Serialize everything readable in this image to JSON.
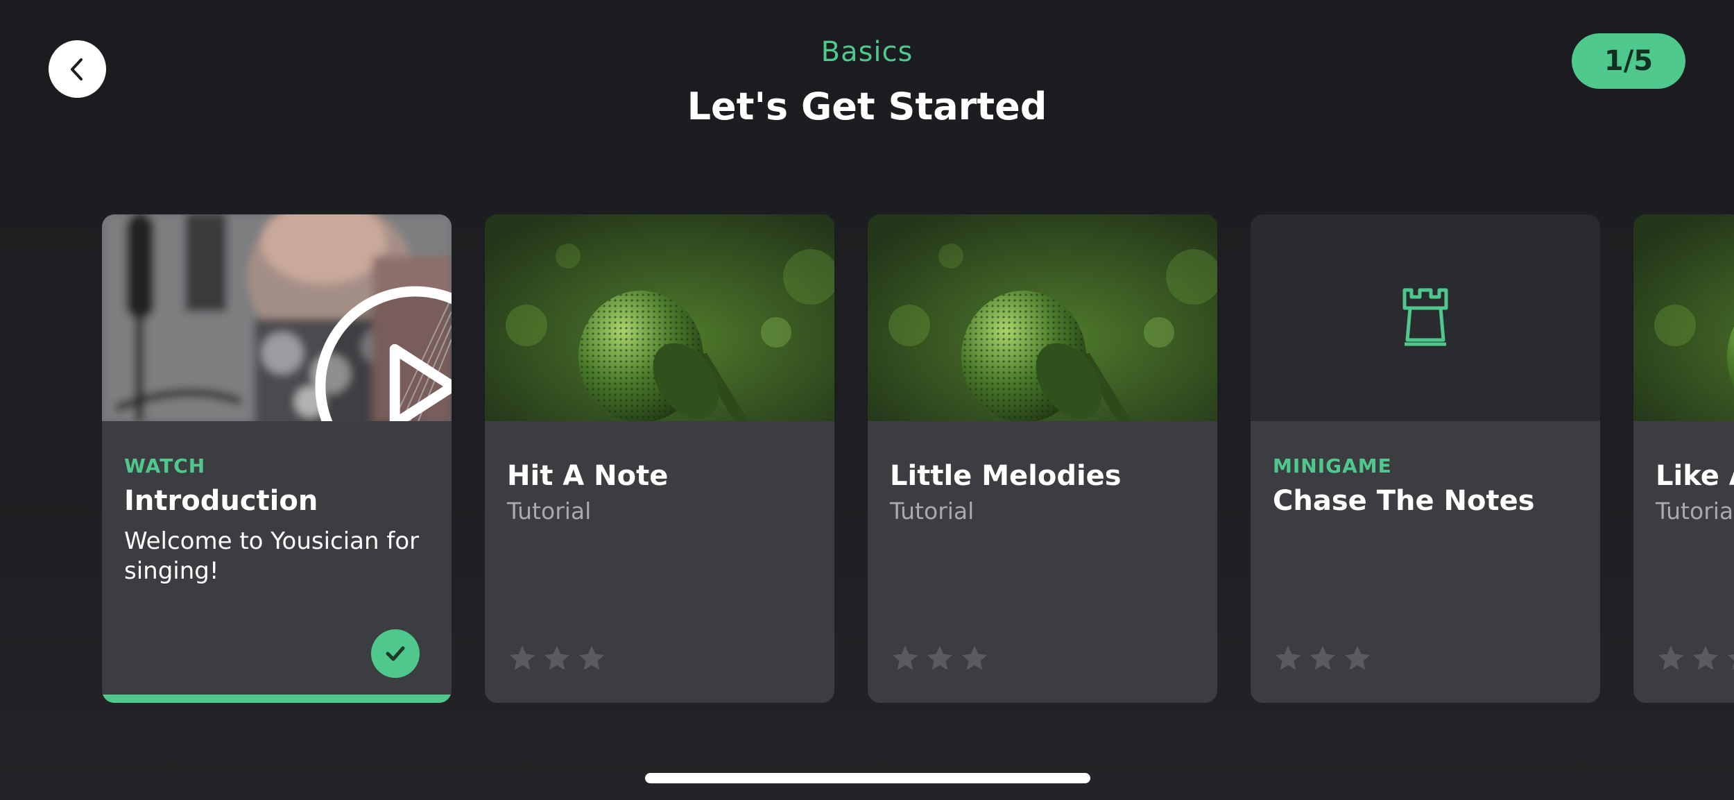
{
  "header": {
    "section": "Basics",
    "title": "Let's Get Started",
    "progress": "1/5"
  },
  "cards": [
    {
      "eyebrow": "WATCH",
      "title": "Introduction",
      "description": "Welcome to Yousician for singing!",
      "image": "singer-video-thumbnail",
      "completed": true
    },
    {
      "title": "Hit A Note",
      "subtitle": "Tutorial",
      "image": "microphone-green",
      "stars": 0
    },
    {
      "title": "Little Melodies",
      "subtitle": "Tutorial",
      "image": "microphone-green",
      "stars": 0
    },
    {
      "eyebrow": "MINIGAME",
      "title": "Chase The Notes",
      "image": "castle-tower-icon",
      "stars": 0
    },
    {
      "title": "Like A",
      "subtitle": "Tutoria",
      "image": "microphone-green",
      "stars": 0
    }
  ],
  "colors": {
    "accent": "#4fc88d",
    "background": "#1c1d20",
    "card": "#3c3d41",
    "star_empty": "#5a5b5f"
  },
  "icons": {
    "back": "chevron-left-icon",
    "play": "play-icon",
    "check": "check-icon",
    "star": "star-icon"
  }
}
